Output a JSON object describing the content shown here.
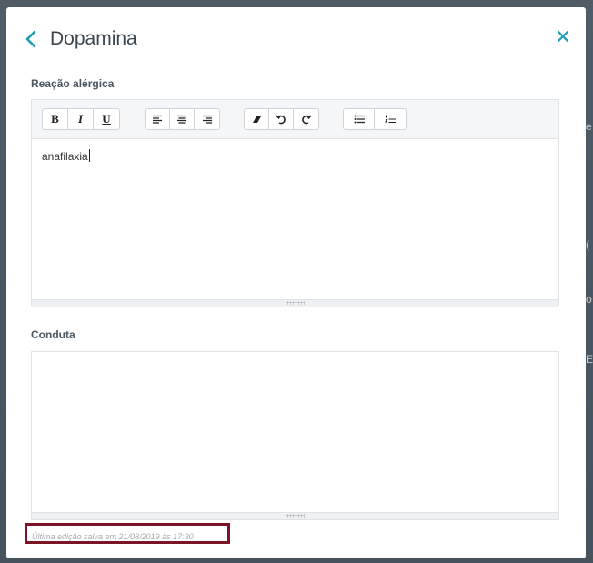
{
  "modal": {
    "title": "Dopamina"
  },
  "reaction": {
    "label": "Reação alérgica",
    "text": "anafilaxia"
  },
  "conduct": {
    "label": "Conduta",
    "text": ""
  },
  "toolbar": {
    "bold": "B",
    "italic": "I",
    "underline": "U"
  },
  "footer": {
    "last_saved": "Última edição salva em 21/08/2019 às 17:30"
  },
  "icons": [
    "chevron-left-icon",
    "close-icon",
    "align-left-icon",
    "align-center-icon",
    "align-right-icon",
    "eraser-icon",
    "undo-icon",
    "redo-icon",
    "bullet-list-icon",
    "numbered-list-icon"
  ],
  "colors": {
    "accent": "#1a9bb5",
    "highlight_border": "#7a1426"
  }
}
